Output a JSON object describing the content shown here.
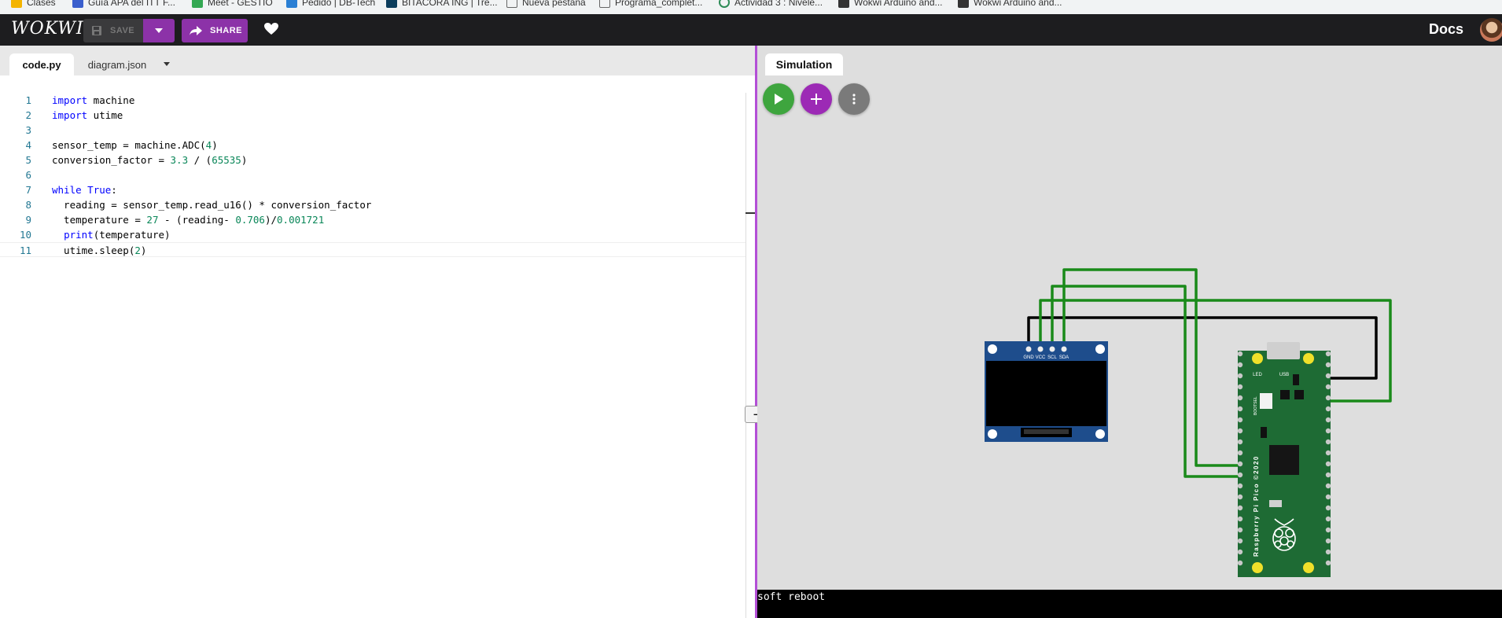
{
  "bookmarks": [
    "Clases",
    "Guía APA del ITT F...",
    "Meet - GESTIO",
    "Pedido | DB-Tech",
    "BITACORA ING | Tre...",
    "Nueva pestaña",
    "Programa_complet...",
    "Actividad 3 : Nivele...",
    "Wokwi Arduino and...",
    "Wokwi Arduino and..."
  ],
  "app": {
    "logo": "WOKWI",
    "save_label": "SAVE",
    "share_label": "SHARE",
    "docs_label": "Docs"
  },
  "editor": {
    "tabs": [
      {
        "label": "code.py",
        "active": true
      },
      {
        "label": "diagram.json",
        "active": false
      }
    ],
    "lines": [
      {
        "n": "1",
        "html": "<span class=\"kw\">import</span> machine"
      },
      {
        "n": "2",
        "html": "<span class=\"kw\">import</span> utime"
      },
      {
        "n": "3",
        "html": ""
      },
      {
        "n": "4",
        "html": "sensor_temp = machine.ADC(<span class=\"num\">4</span>)"
      },
      {
        "n": "5",
        "html": "conversion_factor = <span class=\"num\">3.3</span> / (<span class=\"num\">65535</span>)"
      },
      {
        "n": "6",
        "html": ""
      },
      {
        "n": "7",
        "html": "<span class=\"kw\">while</span> <span class=\"kw\">True</span>:"
      },
      {
        "n": "8",
        "html": "  reading = sensor_temp.read_u16() * conversion_factor"
      },
      {
        "n": "9",
        "html": "  temperature = <span class=\"num\">27</span> - (reading- <span class=\"num\">0.706</span>)/<span class=\"num\">0.001721</span>"
      },
      {
        "n": "10",
        "html": "  <span class=\"bi\">print</span>(temperature)"
      },
      {
        "n": "11",
        "html": "  utime.sleep(<span class=\"num\">2</span>)"
      }
    ],
    "collapse_label": "–"
  },
  "simulation": {
    "tab_label": "Simulation",
    "oled_pins": [
      "GND",
      "VCC",
      "SCL",
      "SDA"
    ],
    "pico_labels": {
      "usb": "USB",
      "led": "LED",
      "bootsel": "BOOTSEL",
      "board": "Raspberry Pi Pico ©2020"
    },
    "wire_color": "#1a8a1a",
    "board_color": "#1e6b34",
    "oled_color": "#1e4d8c"
  },
  "console": {
    "text": "soft reboot"
  }
}
